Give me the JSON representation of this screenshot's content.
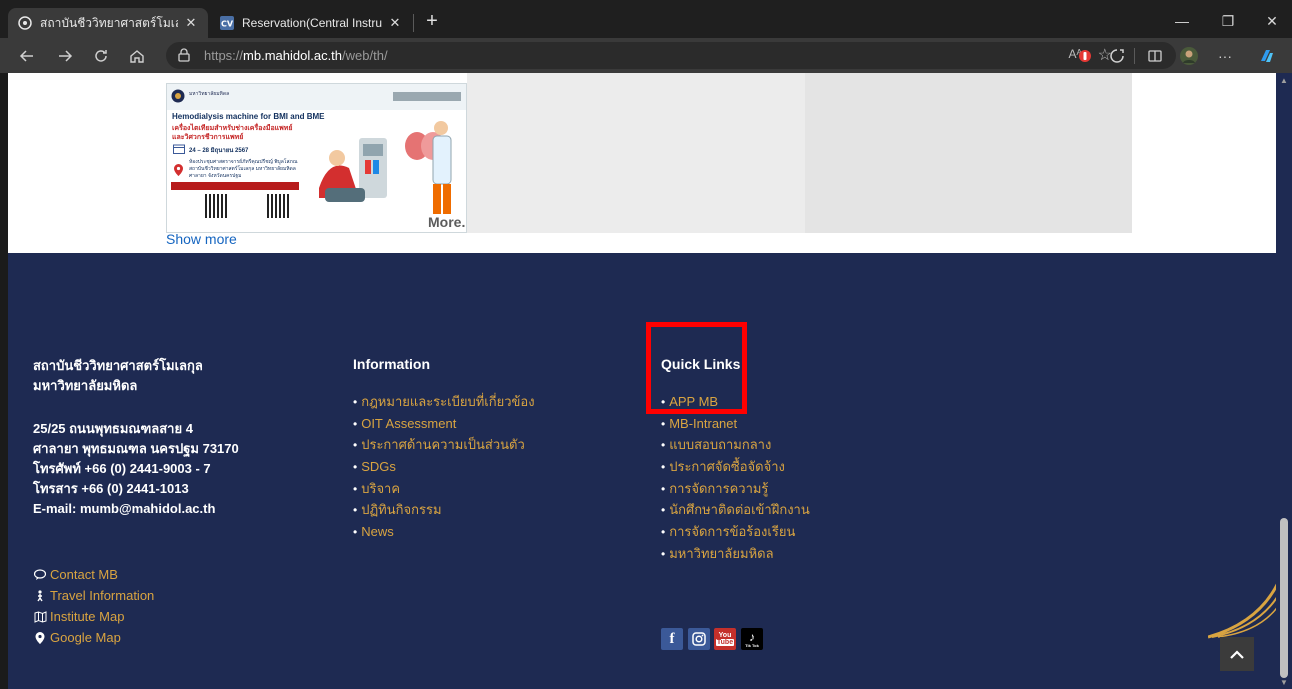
{
  "browser": {
    "tabs": [
      {
        "title": "สถาบันชีววิทยาศาสตร์โมเลกุล, มหาวิท",
        "active": true,
        "favicon": "globe-icon"
      },
      {
        "title": "Reservation(Central Instrument)",
        "active": false,
        "favicon": "cv-logo-icon"
      }
    ],
    "address": {
      "prefix": "https://",
      "host": "mb.mahidol.ac.th",
      "path": "/web/th/"
    },
    "aa_label": "Aᴬ"
  },
  "page": {
    "news_card": {
      "org_name": "มหาวิทยาลัยมหิดล",
      "headline": "Hemodialysis machine for BMI and BME",
      "thai_title_1": "เครื่องไตเทียมสำหรับช่างเครื่องมือแพทย์",
      "thai_title_2": "และวิศวกรชีวการแพทย์",
      "date": "24 – 28 มิถุนายน 2567",
      "venue_1": "ห้องประชุมศาสตราจารย์ภัทรีคุณปรีชญ์ พิบูลโสภณ",
      "venue_2": "สถาบันชีววิทยาศาสตร์โมเลกุล มหาวิทยาลัยมหิดล",
      "venue_3": "ศาลายา จังหวัดนครปฐม",
      "more_label": "More.."
    },
    "show_more": "Show more",
    "footer": {
      "institute_name_1": "สถาบันชีววิทยาศาสตร์โมเลกุล",
      "institute_name_2": "มหาวิทยาลัยมหิดล",
      "address_lines": [
        "25/25 ถนนพุทธมณฑลสาย 4",
        "ศาลายา พุทธมณฑล นครปฐม 73170",
        "โทรศัพท์ +66 (0) 2441-9003 - 7",
        "โทรสาร +66 (0) 2441-1013",
        "E-mail: mumb@mahidol.ac.th"
      ],
      "side_links": [
        {
          "label": "Contact MB",
          "icon": "chat-icon"
        },
        {
          "label": "Travel Information",
          "icon": "person-walking-icon"
        },
        {
          "label": "Institute Map",
          "icon": "map-icon"
        },
        {
          "label": "Google Map",
          "icon": "map-pin-icon"
        }
      ],
      "information_title": "Information",
      "information_links": [
        "กฎหมายและระเบียบที่เกี่ยวข้อง",
        "OIT Assessment",
        "ประกาศด้านความเป็นส่วนตัว",
        "SDGs",
        "บริจาค",
        "ปฏิทินกิจกรรม",
        "News"
      ],
      "quick_links_title": "Quick Links",
      "quick_links": [
        "APP MB",
        "MB-Intranet",
        "แบบสอบถามกลาง",
        "ประกาศจัดซื้อจัดจ้าง",
        "การจัดการความรู้",
        "นักศึกษาติดต่อเข้าฝึกงาน",
        "การจัดการข้อร้องเรียน",
        "มหาวิทยาลัยมหิดล"
      ],
      "social": [
        {
          "name": "facebook-icon",
          "glyph": "f",
          "color": "#3b5998"
        },
        {
          "name": "instagram-icon",
          "glyph": "◎",
          "color": "#3b5998"
        },
        {
          "name": "youtube-icon",
          "glyph": "You Tube",
          "color": "#c4302b"
        },
        {
          "name": "tiktok-icon",
          "glyph": "♪",
          "color": "#000000"
        }
      ],
      "tiktok_caption": "Tik Tok"
    }
  },
  "colors": {
    "footer_bg": "#1e2a52",
    "link_gold": "#d9a441",
    "highlight": "#ff0000"
  }
}
